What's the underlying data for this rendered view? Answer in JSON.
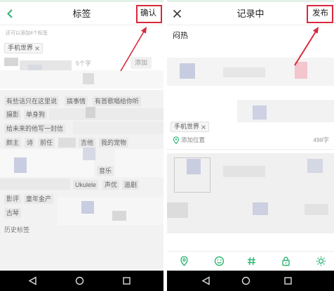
{
  "left_screen": {
    "header": {
      "title": "标签",
      "confirm_label": "确认"
    },
    "hint": "还可以添加4个标签",
    "selected_tags": [
      "手机世界"
    ],
    "input": {
      "counter": "5个字",
      "add_label": "添加"
    },
    "recommended_tags": [
      "有些话只在这里说",
      "搞事情",
      "有首歌唱给你听",
      "摄影",
      "单身狗",
      "给未来的他写一封信",
      "颜主",
      "诗",
      "前任",
      "吉他",
      "我的宠物",
      "音乐",
      "Ukulele",
      "声优",
      "追剧",
      "影评",
      "童年金产",
      "古琴"
    ],
    "history_title": "历史标签"
  },
  "right_screen": {
    "header": {
      "title": "记录中",
      "publish_label": "发布"
    },
    "body_text": "闷热",
    "selected_tags": [
      "手机世界"
    ],
    "location_label": "添加位置",
    "char_count": "498字"
  },
  "icons": {
    "left_back": "chevron-left-icon",
    "right_close": "close-icon",
    "tag_remove": "close-small-icon",
    "location": "location-pin-icon",
    "toolbar": [
      "location-pin-icon",
      "smiley-icon",
      "hash-icon",
      "lock-icon",
      "sun-icon"
    ],
    "system_nav": [
      "back-triangle-icon",
      "home-circle-icon",
      "recents-square-icon"
    ]
  },
  "colors": {
    "accent_green": "#2bb673",
    "annotation_red": "#d9283a",
    "tag_background": "#e8e8e8",
    "system_nav_bar": "#000000"
  }
}
